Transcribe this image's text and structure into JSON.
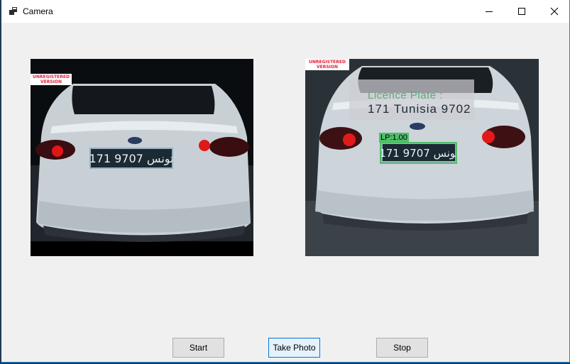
{
  "window": {
    "title": "Camera",
    "icon": "app-window-icon",
    "controls": [
      "minimize-icon",
      "maximize-icon",
      "close-icon"
    ]
  },
  "left_image": {
    "watermark_line1": "UNREGISTERED",
    "watermark_line2": "VERSION",
    "plate_text": "171 تونس 9707"
  },
  "right_image": {
    "watermark_line1": "UNREGISTERED",
    "watermark_line2": "VERSION",
    "overlay_label": "Licence Plate :",
    "overlay_value": "171 Tunisia 9702",
    "detection_tag": "LP:1.00",
    "plate_text": "171 تونس 9707"
  },
  "buttons": {
    "start": "Start",
    "take_photo": "Take Photo",
    "stop": "Stop"
  },
  "colors": {
    "window_bg": "#f0f0f0",
    "accent": "#0078d7",
    "detection_green": "#4fbf6a",
    "watermark_red": "#e0203a"
  }
}
